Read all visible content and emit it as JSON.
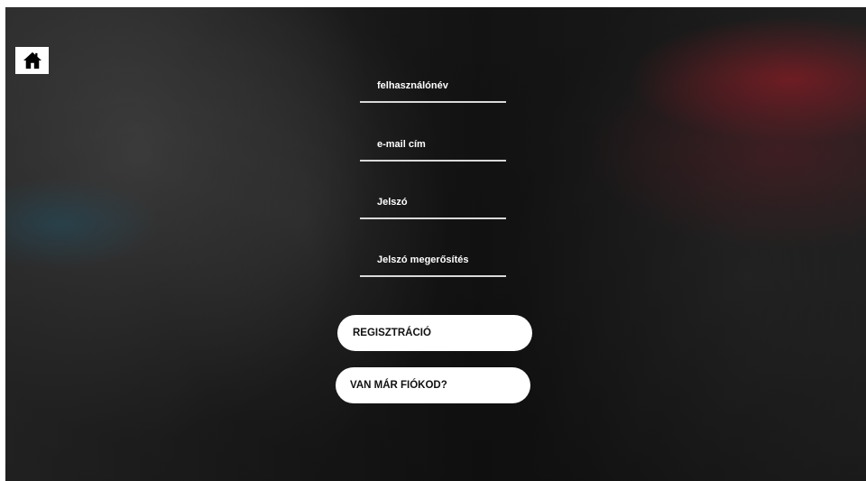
{
  "home": {
    "icon": "home-icon",
    "color": "#000000"
  },
  "form": {
    "username": {
      "value": "",
      "placeholder": "felhasználónév"
    },
    "email": {
      "value": "",
      "placeholder": "e-mail cím"
    },
    "password": {
      "value": "",
      "placeholder": "Jelszó"
    },
    "password_confirm": {
      "value": "",
      "placeholder": "Jelszó megerősítés"
    }
  },
  "buttons": {
    "register_label": "REGISZTRÁCIÓ",
    "have_account_label": "VAN MÁR FIÓKOD?"
  },
  "colors": {
    "button_bg": "#ffffff",
    "button_text": "#111111",
    "field_underline": "#d9d9d9",
    "field_text": "#ffffff"
  }
}
